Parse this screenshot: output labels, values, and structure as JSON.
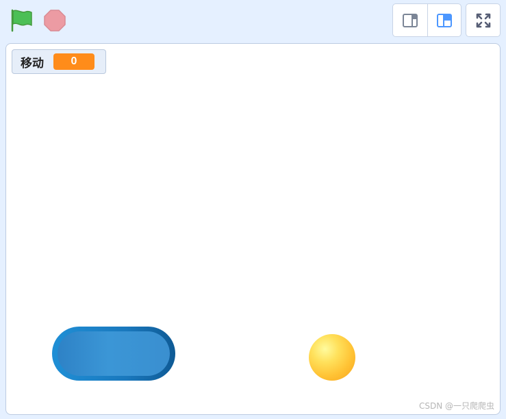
{
  "toolbar": {
    "green_flag_icon": "green-flag-icon",
    "stop_icon": "stop-sign-icon",
    "small_stage_icon": "small-stage-layout-icon",
    "normal_stage_icon": "normal-stage-layout-icon",
    "fullscreen_icon": "fullscreen-icon"
  },
  "stage": {
    "monitor": {
      "label": "移动",
      "value": "0"
    },
    "watermark": "CSDN @一只爬爬虫"
  },
  "colors": {
    "background": "#e5f0ff",
    "monitor_value": "#ff8c1a",
    "green_flag": "#4cbf56",
    "stop": "#ec9ba3",
    "layout_active": "#4c97ff",
    "paddle": "#1f8fd6",
    "ball": "#ffc335"
  }
}
